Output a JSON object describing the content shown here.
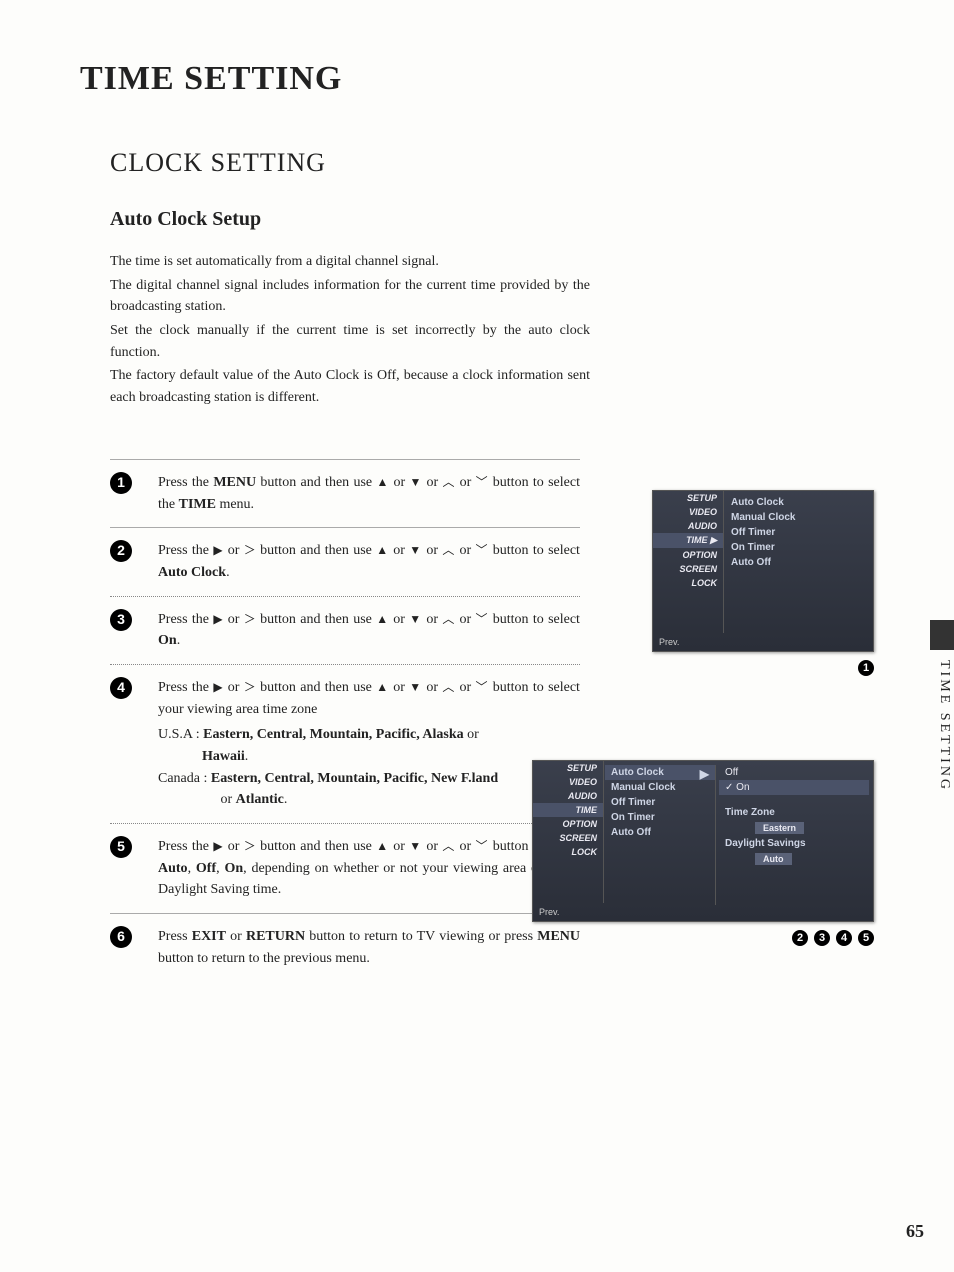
{
  "page_title": "TIME SETTING",
  "section_title": "CLOCK SETTING",
  "sub_title": "Auto Clock Setup",
  "side_label": "TIME SETTING",
  "page_number": "65",
  "intro": {
    "p1": "The time is set automatically from a digital channel signal.",
    "p2": "The digital channel signal includes information for the current time provided by the broadcasting station.",
    "p3": "Set the clock manually if the current time is set incorrectly by the auto clock function.",
    "p4": "The factory default value of the Auto Clock is Off, because a clock information sent each broadcasting station is different."
  },
  "steps": {
    "s1a": "Press the ",
    "s1_menu": "MENU",
    "s1b": " button and then use ",
    "s1c": " or ",
    "s1d": " button to select the ",
    "s1_time": "TIME",
    "s1e": " menu.",
    "s2a": "Press the ",
    "s2b": " button and then use ",
    "s2c": " or ",
    "s2d": " button to select ",
    "s2_ac": "Auto Clock",
    "s2e": ".",
    "s3a": "Press the ",
    "s3b": " button and then use ",
    "s3c": " or ",
    "s3d": " button to select ",
    "s3_on": "On",
    "s3e": ".",
    "s4a": "Press the ",
    "s4b": " button and then use ",
    "s4c": " or ",
    "s4d": " button to select your viewing area time zone",
    "s4_usa_lbl": "U.S.A : ",
    "s4_usa_zones": "Eastern, Central, Mountain, Pacific, Alaska",
    "s4_usa_or": " or ",
    "s4_hawaii": "Hawaii",
    "s4_dot": ".",
    "s4_can_lbl": "Canada : ",
    "s4_can_zones": "Eastern, Central, Mountain, Pacific, New F.land",
    "s4_can_or": " or ",
    "s4_atl": " Atlantic",
    "s5a": "Press the ",
    "s5b": " button and then use ",
    "s5c": " or ",
    "s5d": " button to select ",
    "s5_auto": "Auto",
    "s5_off": "Off",
    "s5_on": "On",
    "s5_comma": ", ",
    "s5e": ", depending on whether or not your viewing area observes Daylight Saving time.",
    "s6a": "Press ",
    "s6_exit": "EXIT",
    "s6b": " or ",
    "s6_return": "RETURN",
    "s6c": " button to return to TV viewing or press ",
    "s6_menu": "MENU",
    "s6d": " button to return to the previous menu."
  },
  "glyphs": {
    "up": "▲",
    "down": "▼",
    "right": "▶",
    "gt": "＞",
    "chev_up": "︿",
    "chev_down": "﹀"
  },
  "osd": {
    "menu_setup": "SETUP",
    "menu_video": "VIDEO",
    "menu_audio": "AUDIO",
    "menu_time": "TIME",
    "menu_option": "OPTION",
    "menu_screen": "SCREEN",
    "menu_lock": "LOCK",
    "prev": "Prev.",
    "auto_clock": "Auto Clock",
    "manual_clock": "Manual Clock",
    "off_timer": "Off Timer",
    "on_timer": "On Timer",
    "auto_off": "Auto Off",
    "off": "Off",
    "on": "On",
    "time_zone": "Time Zone",
    "eastern": "Eastern",
    "daylight": "Daylight Savings",
    "auto": "Auto",
    "check": "✓"
  },
  "badges": {
    "n1": "1",
    "n2": "2",
    "n3": "3",
    "n4": "4",
    "n5": "5",
    "n6": "6"
  }
}
